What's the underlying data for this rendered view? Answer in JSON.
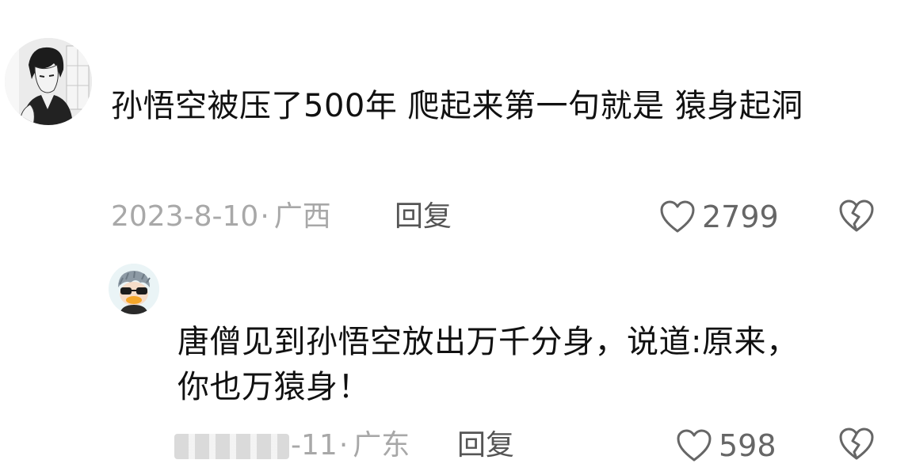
{
  "comment": {
    "avatar_icon": "user-avatar-manga-boy",
    "text": "孙悟空被压了500年 爬起来第一句就是  猿身起洞",
    "date": "2023-8-10",
    "location": "广西",
    "reply_label": "回复",
    "like_count": "2799",
    "like_icon": "heart-outline-icon",
    "dislike_icon": "broken-heart-icon"
  },
  "reply": {
    "avatar_icon": "user-avatar-cartoon-duck",
    "text": "唐僧见到孙悟空放出万千分身，说道:原来，你也万猿身！",
    "date_suffix": "-11",
    "location": "广东",
    "reply_label": "回复",
    "like_count": "598",
    "like_icon": "heart-outline-icon",
    "dislike_icon": "broken-heart-icon"
  },
  "colors": {
    "text": "#111111",
    "meta_gray": "#a8a8a8",
    "reply_gray": "#555555",
    "icon_gray": "#666666"
  }
}
